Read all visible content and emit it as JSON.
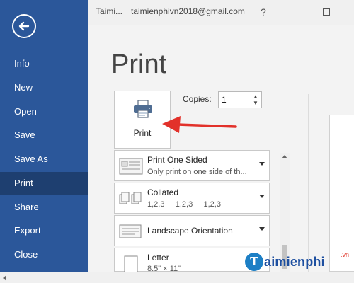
{
  "sidebar": {
    "items": [
      {
        "label": "Info"
      },
      {
        "label": "New"
      },
      {
        "label": "Open"
      },
      {
        "label": "Save"
      },
      {
        "label": "Save As"
      },
      {
        "label": "Print",
        "active": true
      },
      {
        "label": "Share"
      },
      {
        "label": "Export"
      },
      {
        "label": "Close"
      }
    ],
    "back_icon": "back-arrow-icon",
    "color": "#2b579a",
    "active_color": "#1e3f70"
  },
  "titlebar": {
    "account_short": "Taimi...",
    "email": "taimienphivn2018@gmail.com",
    "help": "?",
    "minimize": "–"
  },
  "main": {
    "title": "Print",
    "print_button": {
      "label": "Print",
      "icon": "printer-icon"
    },
    "copies": {
      "label": "Copies:",
      "value": "1"
    },
    "settings": [
      {
        "title": "Print One Sided",
        "subtitle": "Only print on one side of th...",
        "icon": "one-sided-icon"
      },
      {
        "title": "Collated",
        "subtitle": "1,2,3     1,2,3     1,2,3",
        "icon": "collated-icon"
      },
      {
        "title": "Landscape Orientation",
        "subtitle": "",
        "icon": "landscape-icon"
      },
      {
        "title": "Letter",
        "subtitle": "8.5\" × 11\"",
        "icon": "paper-size-icon"
      }
    ]
  },
  "watermark": {
    "brand": "aimienphi",
    "initial": "T",
    "suffix": ".vn"
  }
}
